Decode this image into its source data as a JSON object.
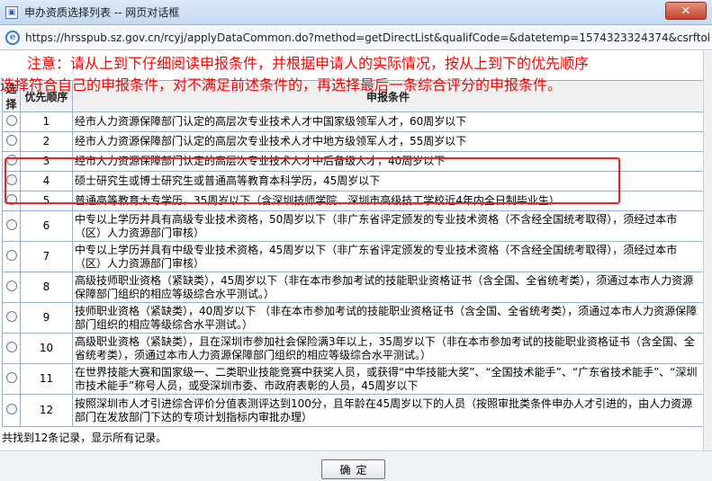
{
  "window": {
    "title": "申办资质选择列表 -- 网页对话框",
    "close_label": "✕"
  },
  "address": {
    "url": "https://hrsspub.sz.gov.cn/rcyj/applyDataCommon.do?method=getDirectList&qualifCode=&datetemp=1574323324374&csrftok"
  },
  "notice": {
    "line1": "注意：请从上到下仔细阅读申报条件，并根据申请人的实际情况，按从上到下的优先顺序",
    "line2": "选择符合自己的申报条件，对不满足前述条件的，再选择最后一条综合评分的申报条件。"
  },
  "table": {
    "headers": [
      "选择",
      "优先顺序",
      "申报条件"
    ],
    "rows": [
      {
        "index": "1",
        "text": "经市人力资源保障部门认定的高层次专业技术人才中国家级领军人才，60周岁以下"
      },
      {
        "index": "2",
        "text": "经市人力资源保障部门认定的高层次专业技术人才中地方级领军人才，55周岁以下"
      },
      {
        "index": "3",
        "text": "经市人力资源保障部门认定的高层次专业技术人才中后备级人才，40周岁以下"
      },
      {
        "index": "4",
        "text": "硕士研究生或博士研究生或普通高等教育本科学历，45周岁以下"
      },
      {
        "index": "5",
        "text": "普通高等教育大专学历，35周岁以下（含深圳技师学院、深圳市高级技工学校近4年内全日制毕业生）"
      },
      {
        "index": "6",
        "text": "中专以上学历并具有高级专业技术资格，50周岁以下（非广东省评定颁发的专业技术资格（不含经全国统考取得），须经过本市（区）人力资源部门审核）"
      },
      {
        "index": "7",
        "text": "中专以上学历并具有中级专业技术资格，45周岁以下（非广东省评定颁发的专业技术资格（不含经全国统考取得），须经过本市（区）人力资源部门审核）"
      },
      {
        "index": "8",
        "text": "高级技师职业资格（紧缺类），45周岁以下（非在本市参加考试的技能职业资格证书（含全国、全省统考类），须通过本市人力资源保障部门组织的相应等级综合水平测试。）"
      },
      {
        "index": "9",
        "text": "技师职业资格（紧缺类），40周岁以下 （非在本市参加考试的技能职业资格证书（含全国、全省统考类），须通过本市人力资源保障部门组织的相应等级综合水平测试。）"
      },
      {
        "index": "10",
        "text": "高级职业资格（紧缺类），且在深圳市参加社会保险满3年以上，35周岁以下（非在本市参加考试的技能职业资格证书（含全国、全省统考类），须通过本市人力资源保障部门组织的相应等级综合水平测试。）"
      },
      {
        "index": "11",
        "text": "在世界技能大赛和国家级一、二类职业技能竞赛中获奖人员，或获得“中华技能大奖”、“全国技术能手”、“广东省技术能手”、“深圳市技术能手”称号人员，或受深圳市委、市政府表彰的人员，45周岁以下"
      },
      {
        "index": "12",
        "text": "按照深圳市人才引进综合评价分值表测评达到100分，且年龄在45周岁以下的人员（按照审批类条件申办人才引进的，由人力资源部门在发放部门下达的专项计划指标内审批办理）"
      }
    ]
  },
  "status": {
    "text": "共找到12条记录，显示所有记录。"
  },
  "footer": {
    "ok_label": "确定"
  },
  "colors": {
    "notice": "#ff0000",
    "highlight": "#e8262b",
    "grid": "#9ab0c8"
  }
}
